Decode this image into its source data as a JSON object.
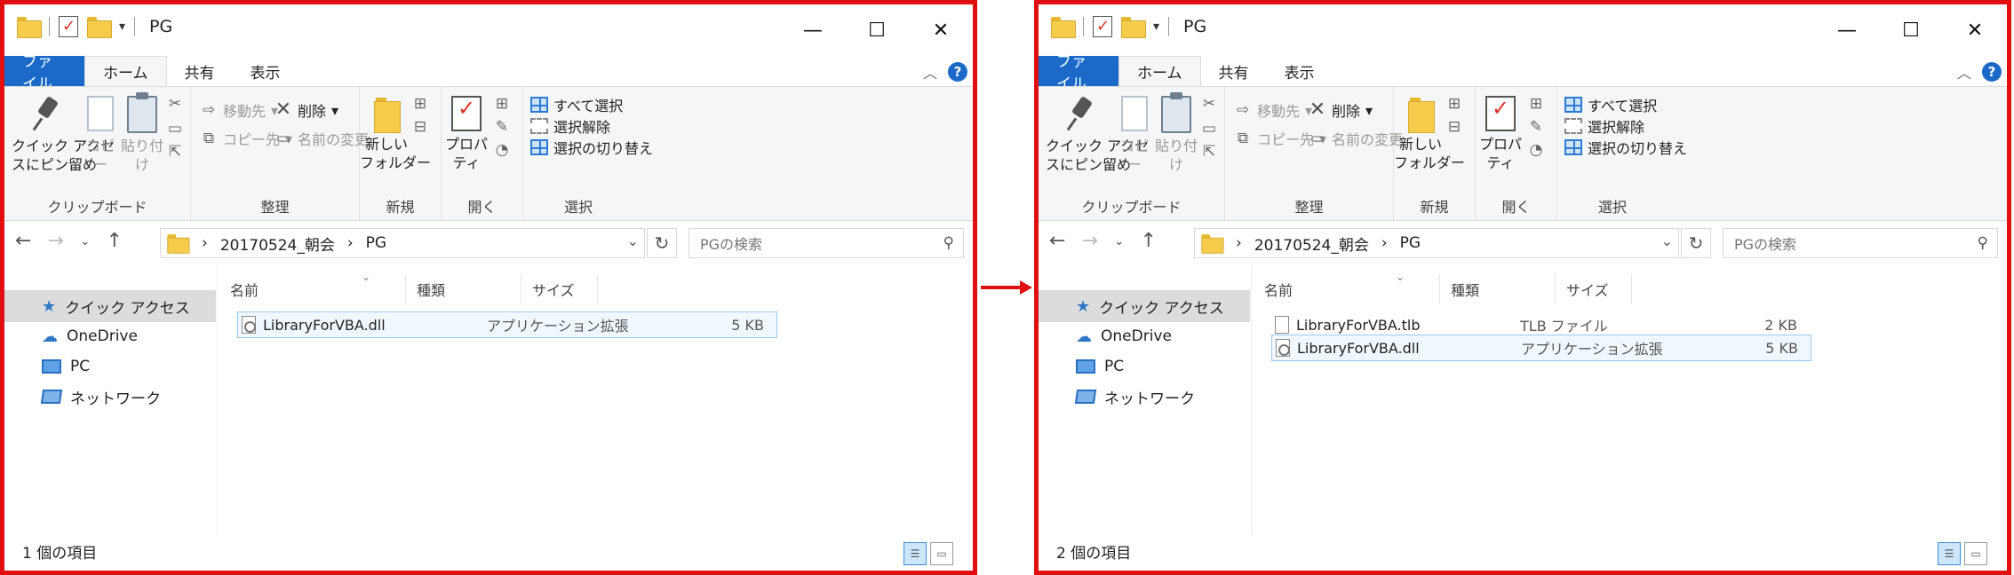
{
  "windows": [
    {
      "title": "PG",
      "tabs": [
        "ファイル",
        "ホーム",
        "共有",
        "表示"
      ],
      "ribbon": {
        "clipboard": {
          "pin": "クイック アクセ\nスにピン留め",
          "copy": "コピー",
          "paste": "貼り付け",
          "label": "クリップボード"
        },
        "organize": {
          "move": "移動先",
          "copyto": "コピー先",
          "delete": "削除",
          "rename": "名前の変更",
          "label": "整理"
        },
        "new": {
          "folder": "新しい\nフォルダー",
          "label": "新規"
        },
        "open": {
          "props": "プロパティ",
          "label": "開く"
        },
        "select": {
          "all": "すべて選択",
          "none": "選択解除",
          "invert": "選択の切り替え",
          "label": "選択"
        }
      },
      "address": {
        "segment1": "20170524_朝会",
        "segment2": "PG",
        "search_placeholder": "PGの検索"
      },
      "nav": [
        "クイック アクセス",
        "OneDrive",
        "PC",
        "ネットワーク"
      ],
      "columns": [
        "名前",
        "種類",
        "サイズ"
      ],
      "files": [
        {
          "name": "LibraryForVBA.dll",
          "type": "アプリケーション拡張",
          "size": "5 KB",
          "icon": "dll-file-icon",
          "selected": true
        }
      ],
      "status": "1 個の項目"
    },
    {
      "title": "PG",
      "tabs": [
        "ファイル",
        "ホーム",
        "共有",
        "表示"
      ],
      "ribbon": {
        "clipboard": {
          "pin": "クイック アクセ\nスにピン留め",
          "copy": "コピー",
          "paste": "貼り付け",
          "label": "クリップボード"
        },
        "organize": {
          "move": "移動先",
          "copyto": "コピー先",
          "delete": "削除",
          "rename": "名前の変更",
          "label": "整理"
        },
        "new": {
          "folder": "新しい\nフォルダー",
          "label": "新規"
        },
        "open": {
          "props": "プロパティ",
          "label": "開く"
        },
        "select": {
          "all": "すべて選択",
          "none": "選択解除",
          "invert": "選択の切り替え",
          "label": "選択"
        }
      },
      "address": {
        "segment1": "20170524_朝会",
        "segment2": "PG",
        "search_placeholder": "PGの検索"
      },
      "nav": [
        "クイック アクセス",
        "OneDrive",
        "PC",
        "ネットワーク"
      ],
      "columns": [
        "名前",
        "種類",
        "サイズ"
      ],
      "files": [
        {
          "name": "LibraryForVBA.tlb",
          "type": "TLB ファイル",
          "size": "2 KB",
          "icon": "tlb-file-icon",
          "selected": false
        },
        {
          "name": "LibraryForVBA.dll",
          "type": "アプリケーション拡張",
          "size": "5 KB",
          "icon": "dll-file-icon",
          "selected": true
        }
      ],
      "status": "2 個の項目"
    }
  ],
  "colors": {
    "frame": "#e01010",
    "file_tab": "#1b6ac9",
    "ribbon_bg": "#f5f6f7",
    "selection": "#99c9ef"
  }
}
